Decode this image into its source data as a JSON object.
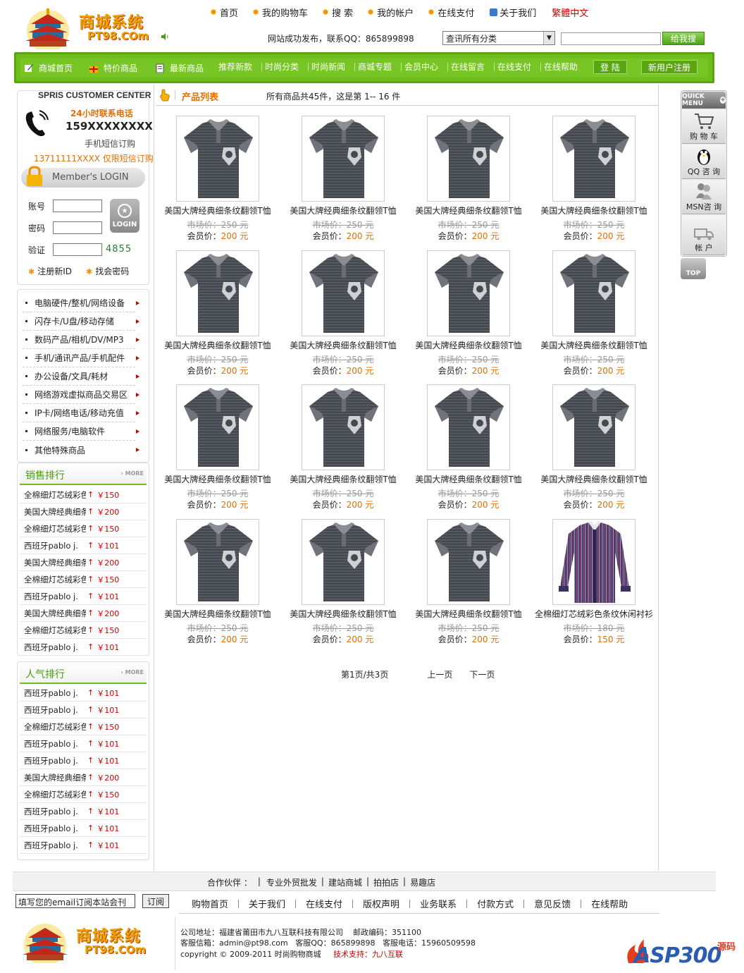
{
  "logo": {
    "title": "商城系统",
    "url": "PT98.COm"
  },
  "topnav": [
    "首页",
    "我的购物车",
    "搜 索",
    "我的帐户",
    "在线支付",
    "关于我们",
    "繁體中文"
  ],
  "notice": "网站成功发布，联系QQ：865899898",
  "search": {
    "category": "查讯所有分类",
    "button": "给我搜",
    "value": ""
  },
  "mainnav": {
    "items": [
      "商城首页",
      "特价商品",
      "最新商品",
      "推荐新款",
      "时尚分类",
      "时尚新闻",
      "商城专题",
      "会员中心",
      "在线留言",
      "在线支付",
      "在线帮助"
    ],
    "login": "登 陆",
    "register": "新用户注册"
  },
  "customer_center": {
    "title": "SPRIS CUSTOMER CENTER",
    "hours": "24小时联系电话",
    "phone": "159XXXXXXXX",
    "sms_note": "手机短信订购",
    "sms_number": "13711111XXXX 仅限短信订购",
    "member_login": "Member's LOGIN",
    "account_label": "账号",
    "password_label": "密码",
    "verify_label": "验证",
    "captcha": "4855",
    "login_button": "LOGIN",
    "register_link": "注册新ID",
    "find_password_link": "找会密码"
  },
  "categories": [
    "电脑硬件/整机/网络设备",
    "闪存卡/U盘/移动存储",
    "数码产品/相机/DV/MP3",
    "手机/通讯产品/手机配件",
    "办公设备/文具/耗材",
    "网络游戏虚拟商品交易区",
    "IP卡/网络电话/移动充值",
    "网络服务/电脑软件",
    "其他特殊商品"
  ],
  "sales_rank": {
    "title": "销售排行",
    "more": "MORE",
    "items": [
      {
        "name": "全棉细灯芯绒彩色条纹",
        "price": "￥150"
      },
      {
        "name": "美国大牌经典细条纹翻",
        "price": "￥200"
      },
      {
        "name": "全棉细灯芯绒彩色条纹",
        "price": "￥150"
      },
      {
        "name": "西班牙pablo j.",
        "price": "￥101"
      },
      {
        "name": "美国大牌经典细条纹翻",
        "price": "￥200"
      },
      {
        "name": "全棉细灯芯绒彩色条纹",
        "price": "￥150"
      },
      {
        "name": "西班牙pablo j.",
        "price": "￥101"
      },
      {
        "name": "美国大牌经典细条纹翻",
        "price": "￥200"
      },
      {
        "name": "全棉细灯芯绒彩色条纹",
        "price": "￥150"
      },
      {
        "name": "西班牙pablo j.",
        "price": "￥101"
      }
    ]
  },
  "popular_rank": {
    "title": "人气排行",
    "more": "MORE",
    "items": [
      {
        "name": "西班牙pablo j.",
        "price": "￥101"
      },
      {
        "name": "西班牙pablo j.",
        "price": "￥101"
      },
      {
        "name": "全棉细灯芯绒彩色条纹",
        "price": "￥150"
      },
      {
        "name": "西班牙pablo j.",
        "price": "￥101"
      },
      {
        "name": "西班牙pablo j.",
        "price": "￥101"
      },
      {
        "name": "美国大牌经典细条纹翻",
        "price": "￥200"
      },
      {
        "name": "全棉细灯芯绒彩色条纹",
        "price": "￥150"
      },
      {
        "name": "西班牙pablo j.",
        "price": "￥101"
      },
      {
        "name": "西班牙pablo j.",
        "price": "￥101"
      },
      {
        "name": "西班牙pablo j.",
        "price": "￥101"
      }
    ]
  },
  "product_list": {
    "title": "产品列表",
    "info": "所有商品共45件，这是第 1-- 16 件",
    "market_label": "市场价：",
    "member_label": "会员价：",
    "unit": "元",
    "products": [
      {
        "name": "美国大牌经典细条纹翻领T恤",
        "market": "250",
        "member": "200",
        "type": "polo"
      },
      {
        "name": "美国大牌经典细条纹翻领T恤",
        "market": "250",
        "member": "200",
        "type": "polo"
      },
      {
        "name": "美国大牌经典细条纹翻领T恤",
        "market": "250",
        "member": "200",
        "type": "polo"
      },
      {
        "name": "美国大牌经典细条纹翻领T恤",
        "market": "250",
        "member": "200",
        "type": "polo"
      },
      {
        "name": "美国大牌经典细条纹翻领T恤",
        "market": "250",
        "member": "200",
        "type": "polo"
      },
      {
        "name": "美国大牌经典细条纹翻领T恤",
        "market": "250",
        "member": "200",
        "type": "polo"
      },
      {
        "name": "美国大牌经典细条纹翻领T恤",
        "market": "250",
        "member": "200",
        "type": "polo"
      },
      {
        "name": "美国大牌经典细条纹翻领T恤",
        "market": "250",
        "member": "200",
        "type": "polo"
      },
      {
        "name": "美国大牌经典细条纹翻领T恤",
        "market": "250",
        "member": "200",
        "type": "polo"
      },
      {
        "name": "美国大牌经典细条纹翻领T恤",
        "market": "250",
        "member": "200",
        "type": "polo"
      },
      {
        "name": "美国大牌经典细条纹翻领T恤",
        "market": "250",
        "member": "200",
        "type": "polo"
      },
      {
        "name": "美国大牌经典细条纹翻领T恤",
        "market": "250",
        "member": "200",
        "type": "polo"
      },
      {
        "name": "美国大牌经典细条纹翻领T恤",
        "market": "250",
        "member": "200",
        "type": "polo"
      },
      {
        "name": "美国大牌经典细条纹翻领T恤",
        "market": "250",
        "member": "200",
        "type": "polo"
      },
      {
        "name": "美国大牌经典细条纹翻领T恤",
        "market": "250",
        "member": "200",
        "type": "polo"
      },
      {
        "name": "全棉细灯芯绒彩色条纹休闲衬衫",
        "market": "180",
        "member": "150",
        "type": "shirt"
      }
    ]
  },
  "pager": {
    "info": "第1页/共3页",
    "prev": "上一页",
    "next": "下一页"
  },
  "quick_menu": {
    "title": "QUICK MENU",
    "items": [
      "购 物 车",
      "QQ 咨 询",
      "MSN咨 询",
      "帐 户"
    ],
    "top": "TOP"
  },
  "partners": {
    "label": "合作伙伴 ：",
    "items": [
      "专业外贸批发",
      "建站商城",
      "拍拍店",
      "易趣店"
    ]
  },
  "subscribe": {
    "placeholder": "填写您的email订阅本站会刊",
    "button": "订阅"
  },
  "footnav": [
    "购物首页",
    "关于我们",
    "在线支付",
    "版权声明",
    "业务联系",
    "付款方式",
    "意见反馈",
    "在线帮助"
  ],
  "footer": {
    "address": "公司地址：福建省莆田市九八互联科技有限公司",
    "postcode": "邮政编码：351100",
    "email": "客服信箱：admin@pt98.com",
    "qq": "客服QQ：865899898",
    "tel": "客服电话：15960509598",
    "copyright": "copyright © 2009-2011  时尚购物商城",
    "support_label": "技术支持：",
    "support_name": "九八互联"
  },
  "watermark": {
    "text": "ASP300",
    "suffix": "源码"
  },
  "colors": {
    "accent": "#6fbe1c",
    "price": "#e07000",
    "link_red": "#cc0000"
  }
}
